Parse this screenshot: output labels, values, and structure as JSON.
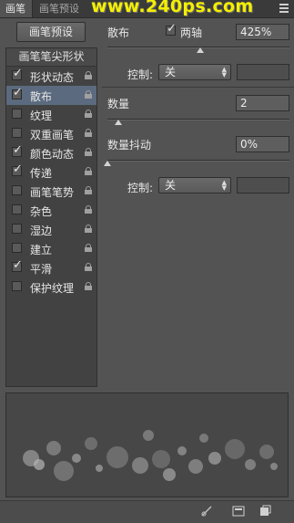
{
  "tabs": [
    {
      "label": "画笔",
      "active": true
    },
    {
      "label": "画笔预设",
      "active": false
    }
  ],
  "watermark": "www.240ps.com",
  "preset_button": "画笔预设",
  "list_header": "画笔笔尖形状",
  "list_items": [
    {
      "label": "形状动态",
      "checked": true,
      "selected": false
    },
    {
      "label": "散布",
      "checked": true,
      "selected": true
    },
    {
      "label": "纹理",
      "checked": false,
      "selected": false
    },
    {
      "label": "双重画笔",
      "checked": false,
      "selected": false
    },
    {
      "label": "颜色动态",
      "checked": true,
      "selected": false
    },
    {
      "label": "传递",
      "checked": true,
      "selected": false
    },
    {
      "label": "画笔笔势",
      "checked": false,
      "selected": false
    },
    {
      "label": "杂色",
      "checked": false,
      "selected": false
    },
    {
      "label": "湿边",
      "checked": false,
      "selected": false
    },
    {
      "label": "建立",
      "checked": false,
      "selected": false
    },
    {
      "label": "平滑",
      "checked": true,
      "selected": false
    },
    {
      "label": "保护纹理",
      "checked": false,
      "selected": false
    }
  ],
  "scatter": {
    "label": "散布",
    "both_axes_label": "两轴",
    "both_axes_checked": true,
    "value": "425%",
    "slider_fraction": 0.51,
    "control_label": "控制:",
    "control_value": "关"
  },
  "count": {
    "label": "数量",
    "value": "2",
    "slider_fraction": 0.06
  },
  "count_jitter": {
    "label": "数量抖动",
    "value": "0%",
    "slider_fraction": 0.0,
    "control_label": "控制:",
    "control_value": "关"
  },
  "colors": {
    "panel": "#535353",
    "selected_row": "#5b6a7e",
    "watermark": "#f4f000"
  },
  "icons": {
    "lock": "lock-icon",
    "toggle_view": "brush-toggle-icon",
    "new_brush": "new-brush-icon",
    "create_preset": "create-preset-icon"
  }
}
